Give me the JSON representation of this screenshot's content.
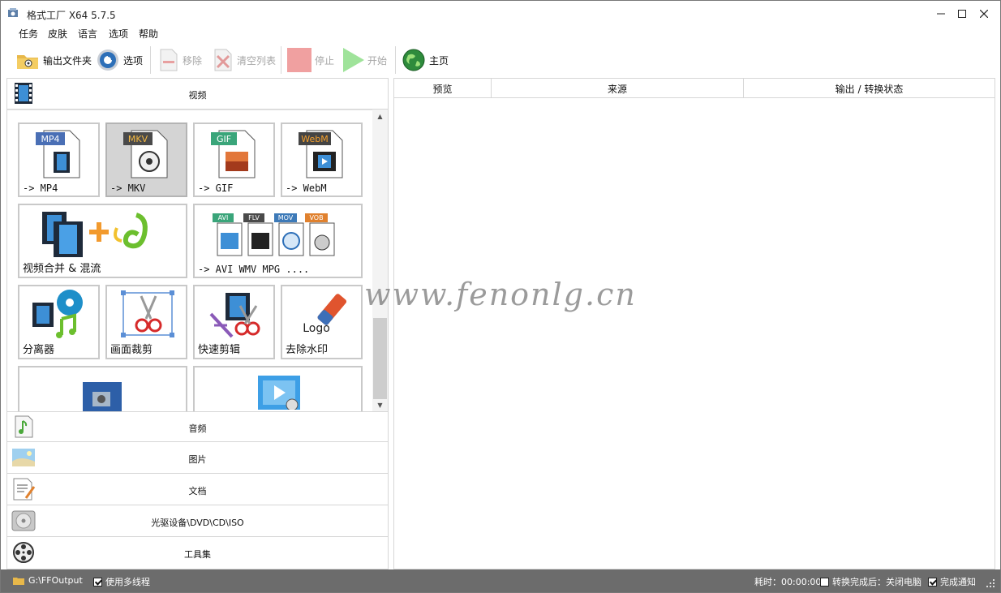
{
  "window": {
    "title": "格式工厂 X64 5.7.5",
    "controls": {
      "minimize": "–",
      "maximize": "☐",
      "close": "✕"
    }
  },
  "menu": [
    "任务",
    "皮肤",
    "语言",
    "选项",
    "帮助"
  ],
  "toolbar": {
    "output_folder": "输出文件夹",
    "options": "选项",
    "remove": "移除",
    "clear_list": "清空列表",
    "stop": "停止",
    "start": "开始",
    "home": "主页"
  },
  "left": {
    "video_label": "视频",
    "tiles": [
      {
        "label": "-> MP4",
        "badge": "MP4",
        "badge_color": "#4a6fb5"
      },
      {
        "label": "-> MKV",
        "badge": "MKV",
        "badge_color": "#4a4a4a",
        "selected": true
      },
      {
        "label": "-> GIF",
        "badge": "GIF",
        "badge_color": "#3aa57a"
      },
      {
        "label": "-> WebM",
        "badge": "WebM",
        "badge_color": "#444444"
      },
      {
        "label": "视频合并 & 混流"
      },
      {
        "label": "-> AVI WMV MPG ....",
        "badges": [
          "AVI",
          "FLV",
          "MOV",
          "VOB"
        ]
      },
      {
        "label": "分离器"
      },
      {
        "label": "画面裁剪"
      },
      {
        "label": "快速剪辑"
      },
      {
        "label": "去除水印",
        "logo_text": "Logo"
      }
    ],
    "categories": [
      "音频",
      "图片",
      "文档",
      "光驱设备\\DVD\\CD\\ISO",
      "工具集"
    ]
  },
  "table": {
    "columns": [
      "预览",
      "来源",
      "输出 / 转换状态"
    ]
  },
  "watermark": "www.fenonlg.cn",
  "status": {
    "output_path": "G:\\FFOutput",
    "multithread_label": "使用多线程",
    "multithread_checked": true,
    "elapsed": "耗时：00:00:00",
    "shutdown_label": "转换完成后：关闭电脑",
    "shutdown_checked": false,
    "notify_label": "完成通知",
    "notify_checked": true
  }
}
